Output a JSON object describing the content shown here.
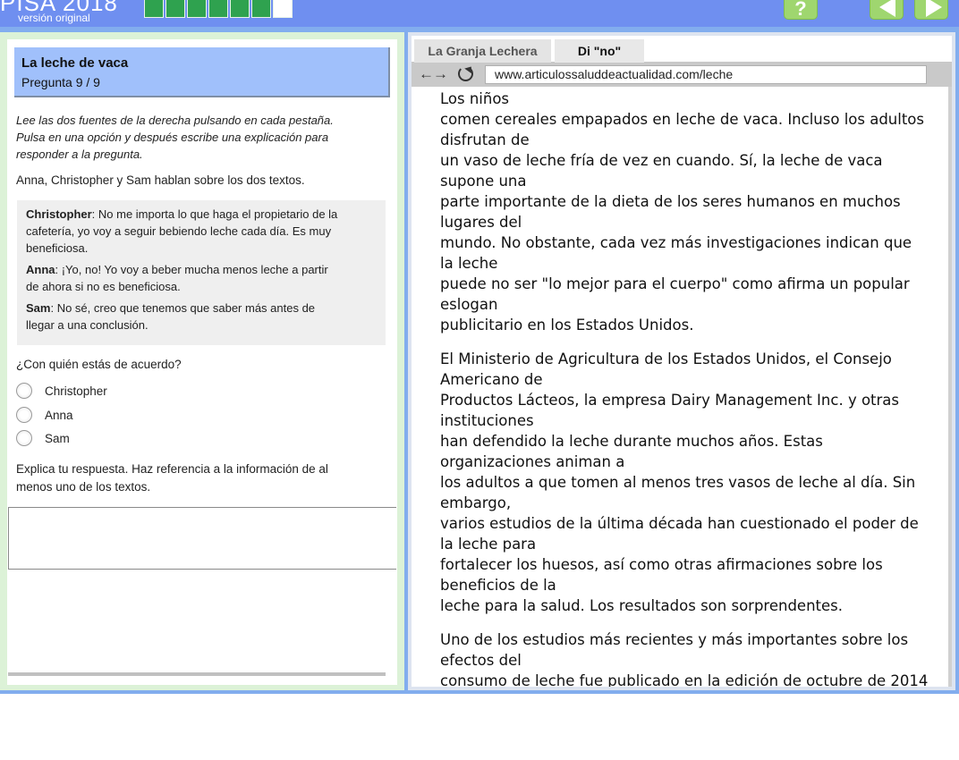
{
  "header": {
    "logo_text": "PISA 2018",
    "version_label": "versión original",
    "progress": {
      "completed": 6,
      "total": 7
    },
    "help_label": "?"
  },
  "left": {
    "title": "La leche de vaca",
    "question_number": "Pregunta  9 /  9",
    "instructions": [
      "Lee las dos fuentes de la derecha pulsando en cada pestaña.",
      "Pulsa en una opción y después escribe una explicación para",
      "responder a la pregunta."
    ],
    "intro": "Anna, Christopher y Sam hablan sobre los dos textos.",
    "dialogue": [
      {
        "speaker": "Christopher",
        "lines": [
          ": No me importa lo que haga el propietario de la",
          "cafetería, yo voy a seguir bebiendo leche cada día. Es muy",
          "beneficiosa."
        ]
      },
      {
        "speaker": "Anna",
        "lines": [
          ": ¡Yo, no! Yo voy a beber mucha menos leche a partir",
          "de ahora si no es beneficiosa."
        ]
      },
      {
        "speaker": "Sam",
        "lines": [
          ": No sé, creo que tenemos que saber más antes de",
          "llegar a una conclusión."
        ]
      }
    ],
    "question": "¿Con quién estás de acuerdo?",
    "options": [
      "Christopher",
      "Anna",
      "Sam"
    ],
    "explain": [
      "Explica tu respuesta. Haz referencia a la información de al",
      "menos uno de los textos."
    ],
    "answer_value": ""
  },
  "right": {
    "tabs": [
      "La Granja Lechera",
      "Di \"no\""
    ],
    "active_tab": 1,
    "url": "www.articulossaluddeactualidad.com/leche",
    "paragraphs": [
      [
        "Los niños",
        "comen cereales empapados en leche de vaca. Incluso los adultos",
        "disfrutan de",
        "un vaso de leche fría de vez en cuando. Sí, la leche de vaca",
        "supone una",
        "parte importante de la dieta de los seres humanos en muchos",
        "lugares del",
        "mundo. No obstante, cada vez más investigaciones indican que",
        "la leche",
        "puede no ser \"lo mejor para el cuerpo\" como afirma un popular",
        "eslogan",
        "publicitario en los Estados Unidos."
      ],
      [
        "El Ministerio de Agricultura de los Estados Unidos, el Consejo",
        "Americano de",
        "Productos Lácteos, la empresa Dairy Management Inc. y otras",
        "instituciones",
        "han defendido la leche durante muchos años. Estas",
        "organizaciones animan a",
        "los adultos a que tomen al menos tres vasos de leche al día. Sin",
        "embargo,",
        "varios estudios de la última década han cuestionado el poder de",
        "la leche para",
        "fortalecer los huesos, así como otras afirmaciones sobre los",
        "beneficios de la",
        "leche para la salud. Los resultados son sorprendentes."
      ],
      [
        "Uno de los estudios más recientes y más importantes sobre los",
        "efectos del",
        "consumo de leche fue publicado en la edición de octubre de 2014"
      ]
    ]
  }
}
